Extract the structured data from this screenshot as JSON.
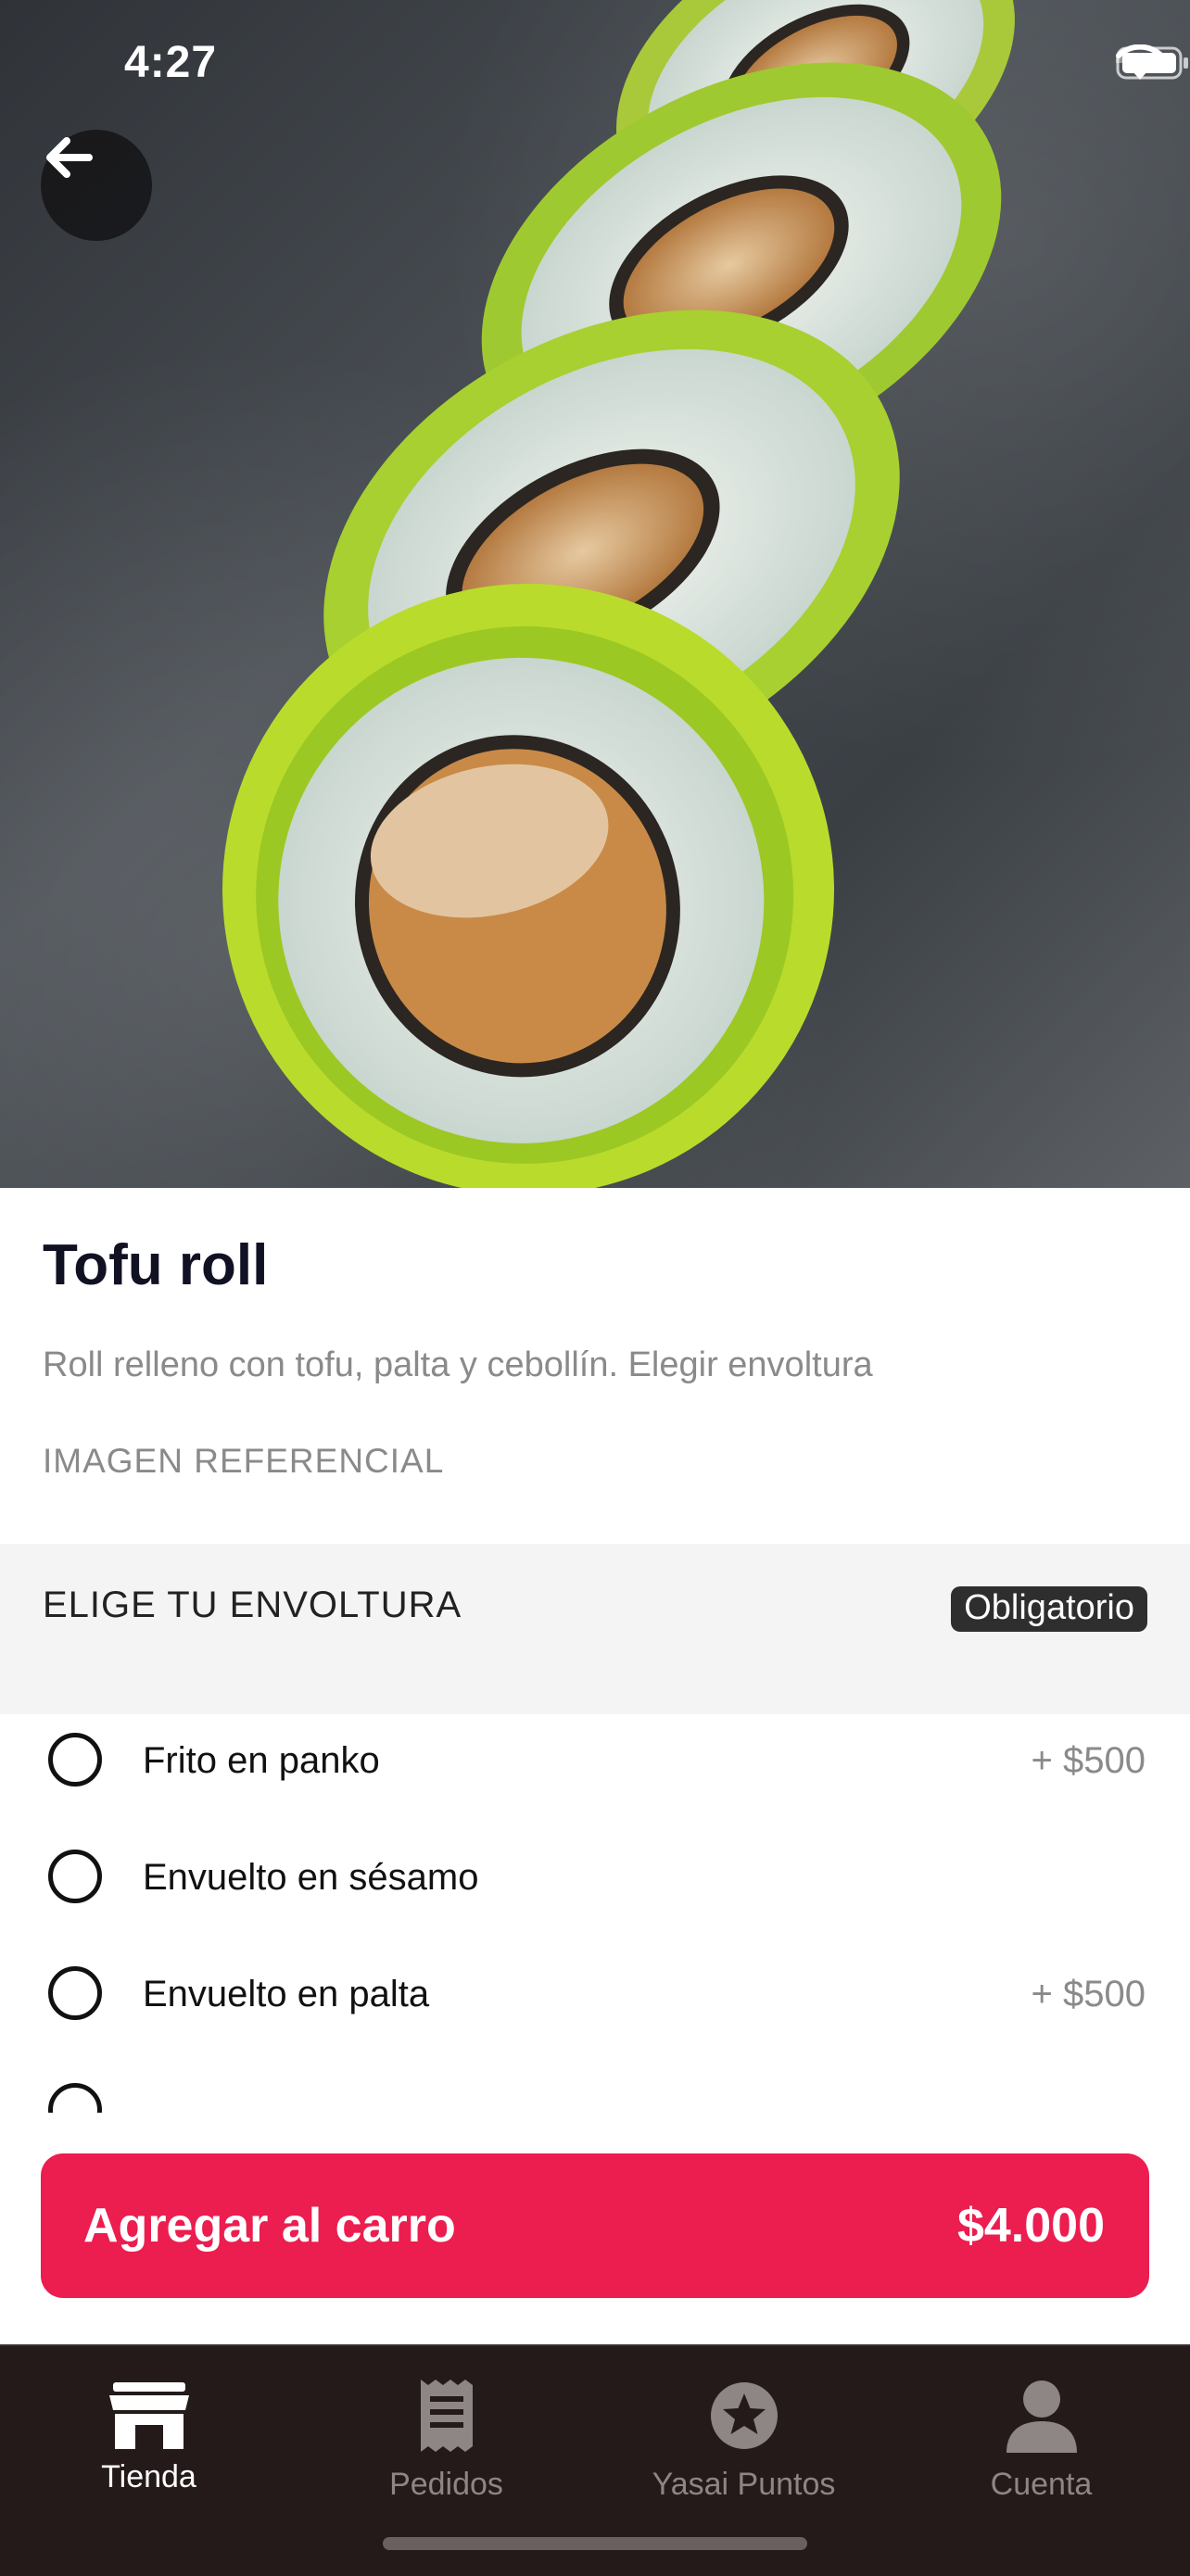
{
  "status_bar": {
    "time": "4:27"
  },
  "product": {
    "title": "Tofu roll",
    "description": "Roll relleno con tofu, palta y cebollín. Elegir envoltura",
    "image_note": "IMAGEN REFERENCIAL"
  },
  "wrap_section": {
    "title": "ELIGE TU ENVOLTURA",
    "badge": "Obligatorio",
    "options": [
      {
        "label": "Frito en panko",
        "price": "+ $500",
        "selected": false
      },
      {
        "label": "Envuelto en sésamo",
        "price": "",
        "selected": false
      },
      {
        "label": "Envuelto en palta",
        "price": "+ $500",
        "selected": false
      }
    ]
  },
  "cart_button": {
    "label": "Agregar al carro",
    "price": "$4.000"
  },
  "tab_bar": {
    "active": "Tienda",
    "tabs": [
      {
        "label": "Tienda",
        "icon": "store-icon"
      },
      {
        "label": "Pedidos",
        "icon": "receipt-icon"
      },
      {
        "label": "Yasai Puntos",
        "icon": "star-icon"
      },
      {
        "label": "Cuenta",
        "icon": "person-icon"
      }
    ]
  },
  "colors": {
    "accent": "#ec1d4f",
    "tab_bar_bg": "#241a1a",
    "title_text": "#111124",
    "muted_text": "#8a8a8a",
    "section_bg": "#f4f4f4"
  },
  "icons": [
    "back-arrow-icon",
    "signal-icon",
    "wifi-icon",
    "battery-icon"
  ]
}
